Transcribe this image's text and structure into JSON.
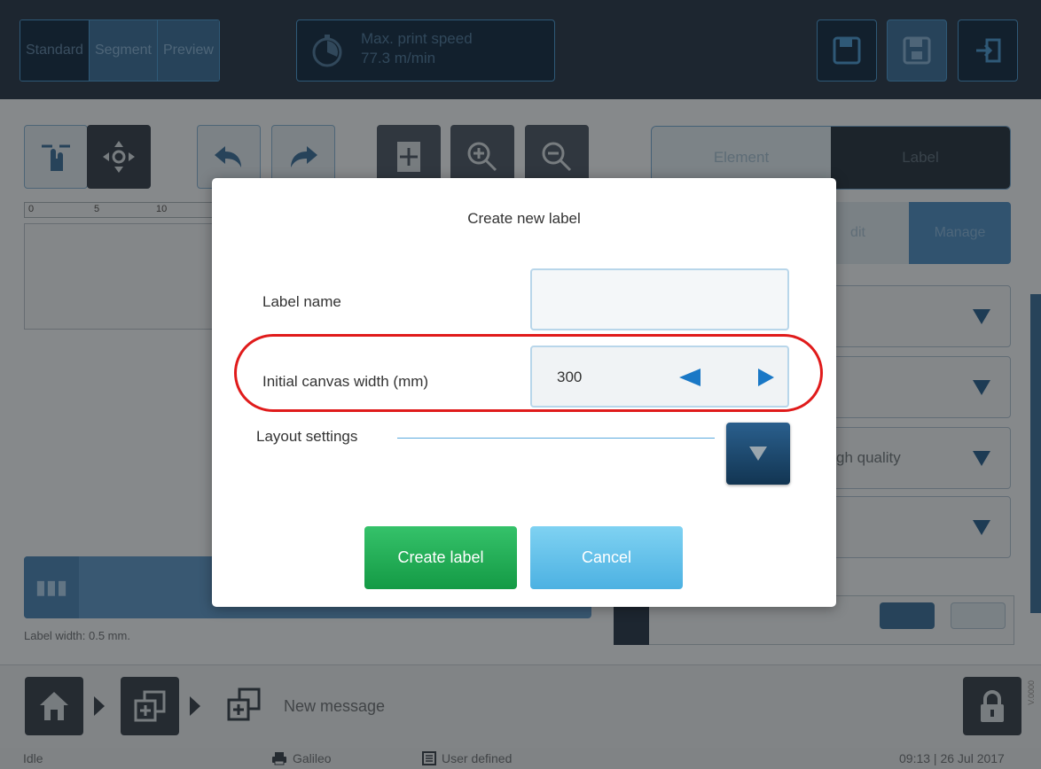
{
  "topbar": {
    "mode_tabs": [
      {
        "label": "Standard"
      },
      {
        "label": "Segment"
      },
      {
        "label": "Preview"
      }
    ],
    "speed_title": "Max. print speed",
    "speed_value": "77.3 m/min"
  },
  "ruler": {
    "ticks": [
      "0",
      "5",
      "10"
    ]
  },
  "editor": {
    "label_width": "Label width: 0.5 mm."
  },
  "panel": {
    "tabs": [
      {
        "label": "Element"
      },
      {
        "label": "Label"
      }
    ],
    "subtabs": [
      {
        "label": "dit"
      },
      {
        "label": "Manage"
      }
    ],
    "dropdown_partial_text": "gh quality"
  },
  "footer": {
    "current_message": "New message",
    "version_code": "V.0000"
  },
  "status": {
    "state": "Idle",
    "printer": "Galileo",
    "mode": "User defined",
    "datetime": "09:13 | 26 Jul 2017"
  },
  "modal": {
    "title": "Create new label",
    "label_name_label": "Label name",
    "label_name_value": "",
    "canvas_width_label": "Initial canvas width (mm)",
    "canvas_width_value": "300",
    "layout_settings_label": "Layout settings",
    "create_button": "Create label",
    "cancel_button": "Cancel"
  },
  "colors": {
    "highlight": "#e01b1b",
    "create_button": "#1fa852",
    "cancel_button": "#5fc1ea",
    "stepper_arrow": "#1a78c6"
  }
}
